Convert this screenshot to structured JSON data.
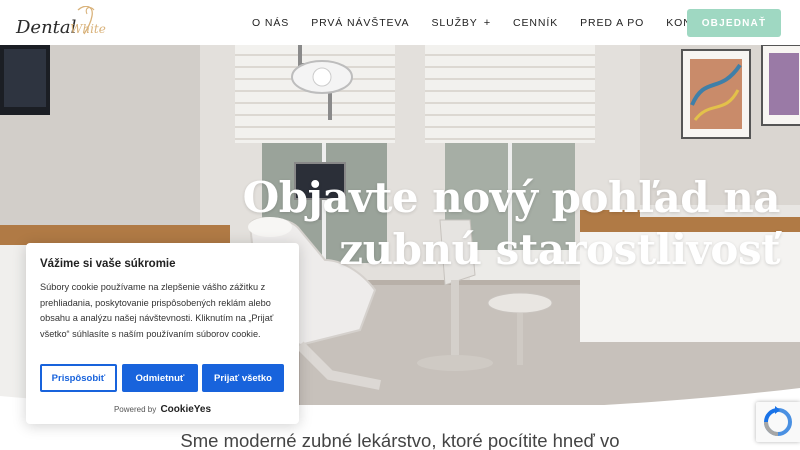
{
  "brand": {
    "logo_text_1": "Dental",
    "logo_text_2": "White",
    "accent_color": "#9fd8c2"
  },
  "nav": {
    "items": [
      {
        "label": "O NÁS"
      },
      {
        "label": "PRVÁ NÁVŠTEVA"
      },
      {
        "label": "SLUŽBY",
        "suffix": "+"
      },
      {
        "label": "CENNÍK"
      },
      {
        "label": "PRED A PO"
      },
      {
        "label": "KONTAKT"
      }
    ],
    "cta_label": "OBJEDNAŤ"
  },
  "hero": {
    "title_line1": "Objavte nový pohľad na",
    "title_line2": "zubnú starostlivosť"
  },
  "intro": {
    "subtitle": "Sme moderné zubné lekárstvo, ktoré pocítite hneď vo"
  },
  "cookie_banner": {
    "title": "Vážime si vaše súkromie",
    "text": "Súbory cookie používame na zlepšenie vášho zážitku z prehliadania, poskytovanie prispôsobených reklám alebo obsahu a analýzu našej návštevnosti. Kliknutím na „Prijať všetko“ súhlasíte s naším používaním súborov cookie.",
    "customize_label": "Prispôsobiť",
    "reject_label": "Odmietnuť",
    "accept_label": "Prijať všetko",
    "powered_by": "Powered by",
    "powered_brand": "CookieYes",
    "button_color": "#1863dc"
  },
  "recaptcha": {
    "icon": "recaptcha-icon"
  }
}
